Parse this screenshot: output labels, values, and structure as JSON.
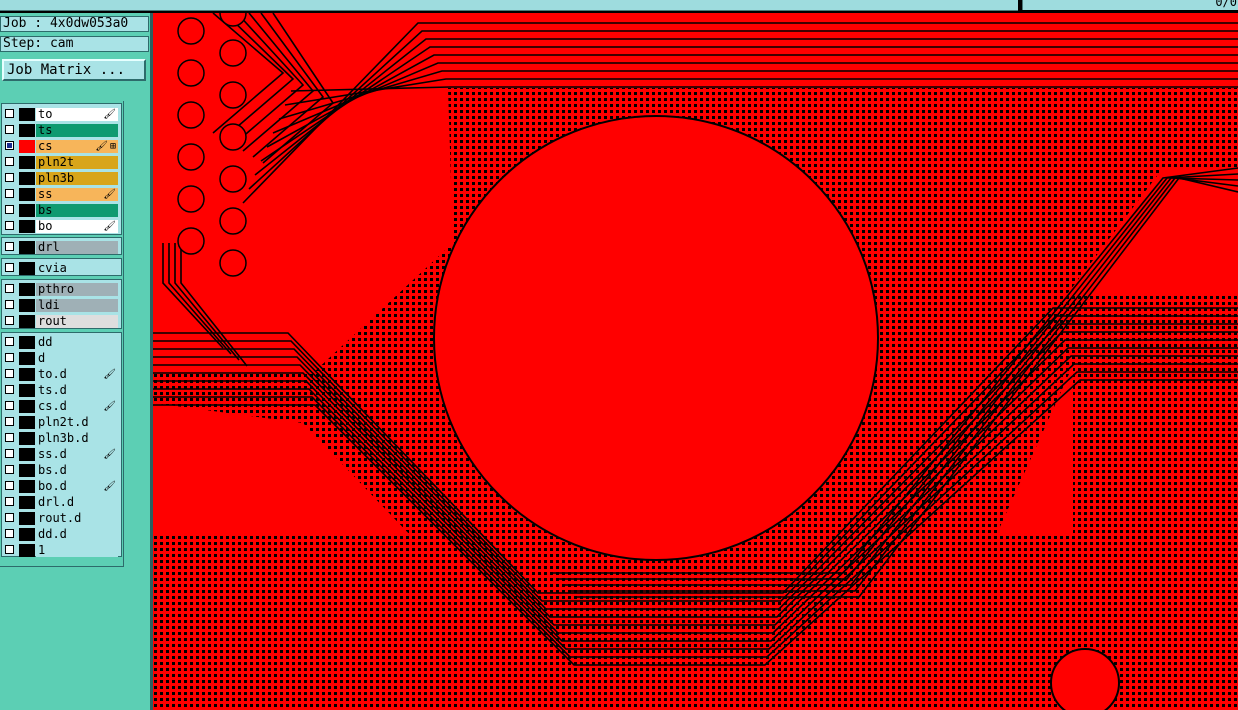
{
  "topbar": {
    "coord_text": "0/0"
  },
  "job": {
    "label": "Job : 4x0dw053a0",
    "step": "Step: cam"
  },
  "buttons": {
    "job_matrix": "Job Matrix ..."
  },
  "colors": {
    "canvas": "#ff0000",
    "panel": "#5ccfb4",
    "row_default": "#a9e3e6"
  },
  "layers": [
    {
      "name": "to",
      "checked": false,
      "color": "#000000",
      "bg": "#ffffff",
      "mark": "🖌"
    },
    {
      "name": "ts",
      "checked": false,
      "color": "#000000",
      "bg": "#0e9a70",
      "mark": ""
    },
    {
      "name": "cs",
      "checked": true,
      "color": "#ff0000",
      "bg": "#f7b55a",
      "mark": "🖌",
      "mark2": "⊞"
    },
    {
      "name": "pln2t",
      "checked": false,
      "color": "#000000",
      "bg": "#d8a51a",
      "mark": ""
    },
    {
      "name": "pln3b",
      "checked": false,
      "color": "#000000",
      "bg": "#d8a51a",
      "mark": ""
    },
    {
      "name": "ss",
      "checked": false,
      "color": "#000000",
      "bg": "#f7b55a",
      "mark": "🖌"
    },
    {
      "name": "bs",
      "checked": false,
      "color": "#000000",
      "bg": "#0e9a70",
      "mark": ""
    },
    {
      "name": "bo",
      "checked": false,
      "color": "#000000",
      "bg": "#ffffff",
      "mark": "🖌"
    },
    {
      "name": "drl",
      "checked": false,
      "color": "#000000",
      "bg": "#9fb0b6",
      "mark": ""
    },
    {
      "name": "cvia",
      "checked": false,
      "color": "#000000",
      "bg": "#a9e3e6",
      "mark": ""
    },
    {
      "name": "pthro",
      "checked": false,
      "color": "#000000",
      "bg": "#9fb0b6",
      "mark": ""
    },
    {
      "name": "ldi",
      "checked": false,
      "color": "#000000",
      "bg": "#9fb0b6",
      "mark": ""
    },
    {
      "name": "rout",
      "checked": false,
      "color": "#000000",
      "bg": "#dedede",
      "mark": ""
    },
    {
      "name": "dd",
      "checked": false,
      "color": "#000000",
      "bg": "#a9e3e6",
      "mark": ""
    },
    {
      "name": "d",
      "checked": false,
      "color": "#000000",
      "bg": "#a9e3e6",
      "mark": ""
    },
    {
      "name": "to.d",
      "checked": false,
      "color": "#000000",
      "bg": "#a9e3e6",
      "mark": "🖌"
    },
    {
      "name": "ts.d",
      "checked": false,
      "color": "#000000",
      "bg": "#a9e3e6",
      "mark": ""
    },
    {
      "name": "cs.d",
      "checked": false,
      "color": "#000000",
      "bg": "#a9e3e6",
      "mark": "🖌"
    },
    {
      "name": "pln2t.d",
      "checked": false,
      "color": "#000000",
      "bg": "#a9e3e6",
      "mark": ""
    },
    {
      "name": "pln3b.d",
      "checked": false,
      "color": "#000000",
      "bg": "#a9e3e6",
      "mark": ""
    },
    {
      "name": "ss.d",
      "checked": false,
      "color": "#000000",
      "bg": "#a9e3e6",
      "mark": "🖌"
    },
    {
      "name": "bs.d",
      "checked": false,
      "color": "#000000",
      "bg": "#a9e3e6",
      "mark": ""
    },
    {
      "name": "bo.d",
      "checked": false,
      "color": "#000000",
      "bg": "#a9e3e6",
      "mark": "🖌"
    },
    {
      "name": "drl.d",
      "checked": false,
      "color": "#000000",
      "bg": "#a9e3e6",
      "mark": ""
    },
    {
      "name": "rout.d",
      "checked": false,
      "color": "#000000",
      "bg": "#a9e3e6",
      "mark": ""
    },
    {
      "name": "dd.d",
      "checked": false,
      "color": "#000000",
      "bg": "#a9e3e6",
      "mark": ""
    },
    {
      "name": "1",
      "checked": false,
      "color": "#000000",
      "bg": "#a9e3e6",
      "mark": ""
    }
  ]
}
